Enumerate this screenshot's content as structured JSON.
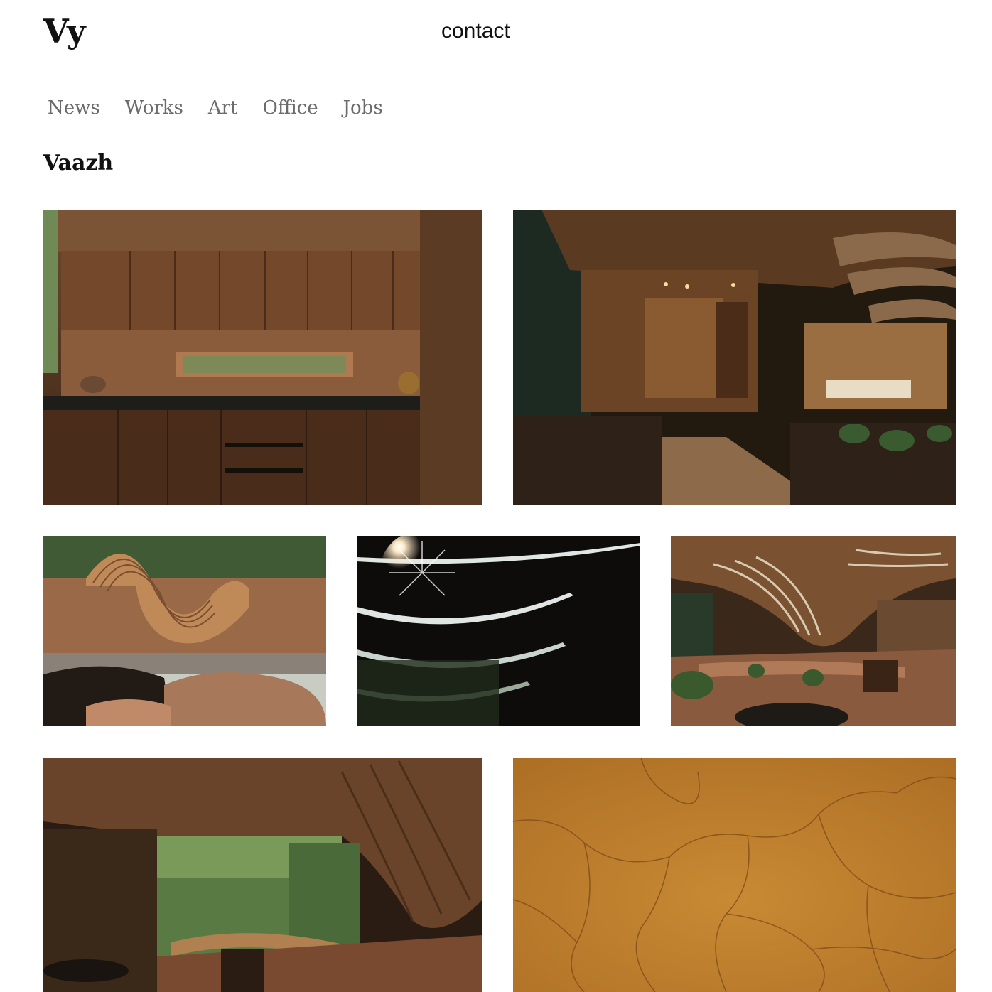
{
  "header": {
    "logo": "Vy",
    "contact_label": "contact"
  },
  "nav": {
    "items": [
      {
        "label": "News"
      },
      {
        "label": "Works"
      },
      {
        "label": "Art"
      },
      {
        "label": "Office"
      },
      {
        "label": "Jobs"
      }
    ]
  },
  "project": {
    "title": "Vaazh"
  },
  "gallery": {
    "images": [
      {
        "subject": "kitchen interior with wooden cabinets and a long horizontal window"
      },
      {
        "subject": "dusk view of a corridor under a wave-shaped timber roof"
      },
      {
        "subject": "exterior earth walls with a wavy timber roof and resting cows"
      },
      {
        "subject": "sunburst through curved timber roof slats"
      },
      {
        "subject": "open living space under the curving timber roof"
      },
      {
        "subject": "interior courtyard view framed by the curved roof and trees"
      },
      {
        "subject": "close-up of cracked ochre earth plaster"
      }
    ]
  },
  "colors": {
    "text": "#111111",
    "nav_text": "#6b6b6b",
    "background": "#ffffff"
  }
}
